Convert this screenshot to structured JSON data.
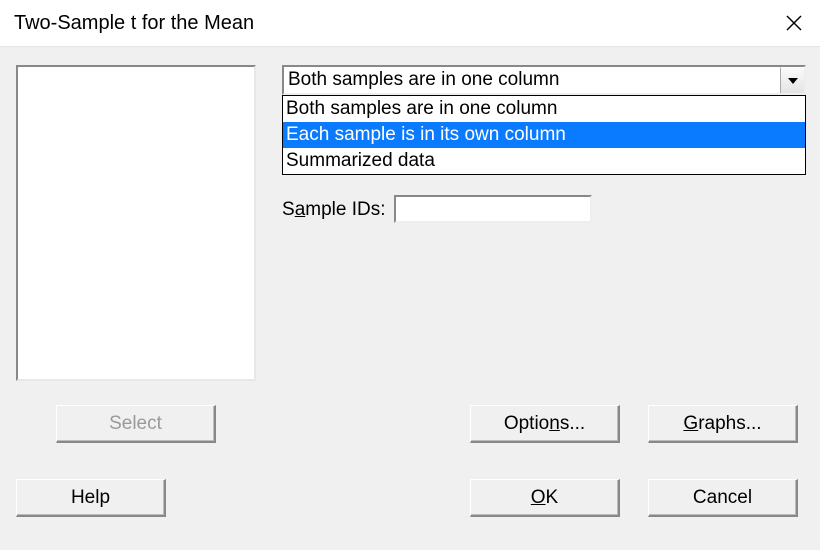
{
  "window": {
    "title": "Two-Sample t for the Mean"
  },
  "combo": {
    "selected": "Both samples are in one column",
    "options": [
      {
        "label": "Both samples are in one column",
        "selected": false
      },
      {
        "label": "Each sample is in its own column",
        "selected": true
      },
      {
        "label": "Summarized data",
        "selected": false
      }
    ]
  },
  "sample_ids": {
    "label_pre": "S",
    "label_u": "a",
    "label_post": "mple IDs:",
    "value": ""
  },
  "buttons": {
    "select": "Select",
    "options_pre": "Optio",
    "options_u": "n",
    "options_post": "s...",
    "graphs_u": "G",
    "graphs_post": "raphs...",
    "help": "Help",
    "ok_u": "O",
    "ok_post": "K",
    "cancel": "Cancel"
  }
}
